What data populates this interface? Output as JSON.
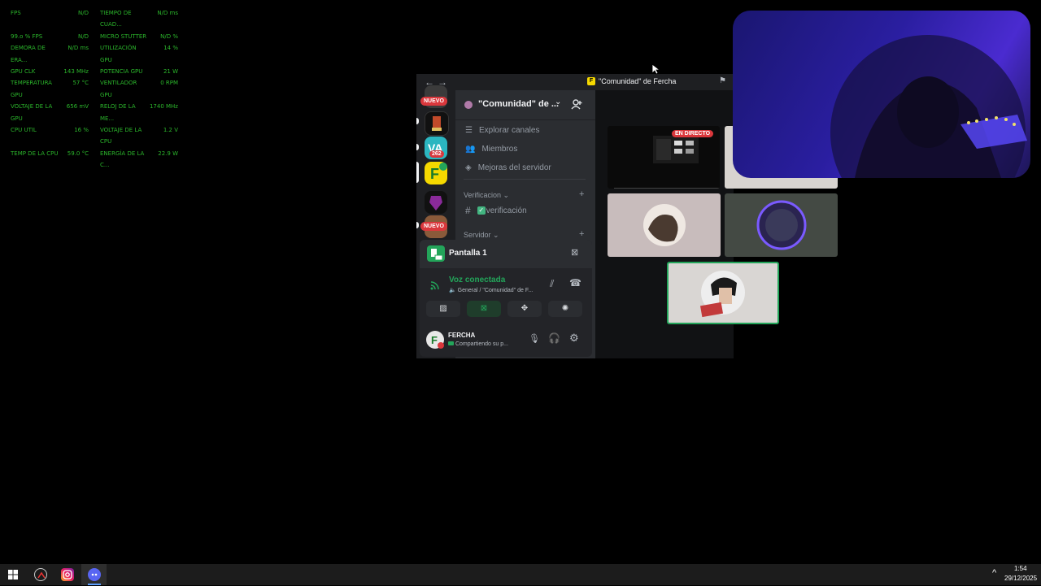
{
  "overlay": {
    "rows": [
      [
        "FPS",
        "N/D",
        "TIEMPO DE CUAD...",
        "N/D ms"
      ],
      [
        "99.o % FPS",
        "N/D",
        "MICRO STUTTER",
        "N/D %"
      ],
      [
        "DEMORA DE ERA...",
        "N/D ms",
        "UTILIZACIÓN GPU",
        "14 %"
      ],
      [
        "GPU CLK",
        "143 MHz",
        "POTENCIA GPU",
        "21 W"
      ],
      [
        "TEMPERATURA GPU",
        "57 °C",
        "VENTILADOR GPU",
        "0 RPM"
      ],
      [
        "VOLTAJE DE LA GPU",
        "656 mV",
        "RELOJ DE LA ME...",
        "1740 MHz"
      ],
      [
        "CPU UTIL",
        "16 %",
        "VOLTAJE DE LA CPU",
        "1.2 V"
      ],
      [
        "TEMP DE LA CPU",
        "59.0 °C",
        "ENERGÍA DE LA C...",
        "22.9 W"
      ]
    ]
  },
  "window": {
    "title": "\"Comunidad\" de Fercha",
    "title_icon_letter": "F",
    "back_arrow": "←",
    "forward_arrow": "→"
  },
  "guilds": {
    "new_badge_top": "NUEVO",
    "new_badge_bottom": "NUEVO",
    "count_badge": "262"
  },
  "server": {
    "name": "\"Comunidad\" de ...",
    "channels": [
      {
        "label": "Explorar canales",
        "icon": "list-icon"
      },
      {
        "label": "Miembros",
        "icon": "members-icon"
      },
      {
        "label": "Mejoras del servidor",
        "icon": "boost-icon"
      }
    ],
    "categories": {
      "verificacion": "Verificacion",
      "servidor": "Servidor"
    },
    "verification_channel": "verificación"
  },
  "voice_panel": {
    "screen_label": "Pantalla 1",
    "status": "Voz conectada",
    "location": "General / \"Comunidad\" de F...",
    "user_name": "FERCHA",
    "user_status": "Compartiendo su p..."
  },
  "stream": {
    "live_badge": "EN DIRECTO"
  },
  "taskbar": {
    "time": "1:54",
    "date": "29/12/2025"
  },
  "colors": {
    "overlay_text": "#2bb52b",
    "discord_bg": "#2b2d31",
    "voice_green": "#23a55a",
    "badge_red": "#da373c",
    "fercha_yellow": "#f5d800"
  }
}
